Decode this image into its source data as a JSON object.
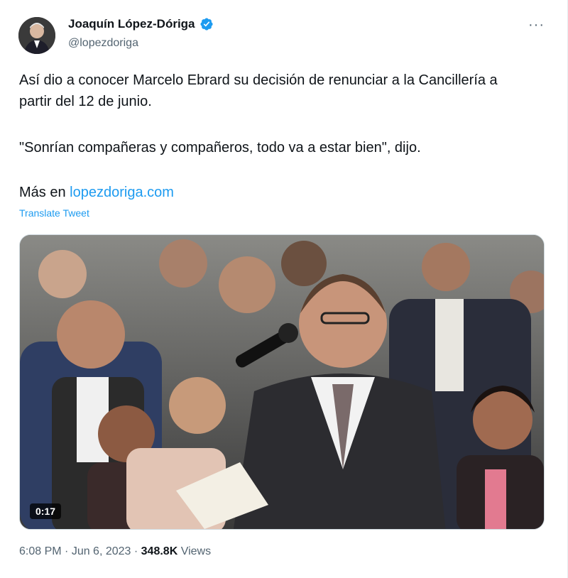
{
  "author": {
    "name": "Joaquín López-Dóriga",
    "handle": "@lopezdoriga",
    "verified_color": "#1d9bf0"
  },
  "menu": {
    "more_label": "···"
  },
  "tweet": {
    "text_line1": "Así dio a conocer Marcelo Ebrard su decisión de renunciar a la Cancillería a partir del 12 de junio.",
    "text_line2": "\"Sonrían compañeras y compañeros, todo va a estar bien\", dijo.",
    "text_more_prefix": "Más en ",
    "link_text": "lopezdoriga.com",
    "translate_label": "Translate Tweet"
  },
  "video": {
    "duration": "0:17"
  },
  "meta": {
    "time": "6:08 PM",
    "separator1": " · ",
    "date": "Jun 6, 2023",
    "separator2": " · ",
    "views_count": "348.8K",
    "views_label": " Views"
  }
}
